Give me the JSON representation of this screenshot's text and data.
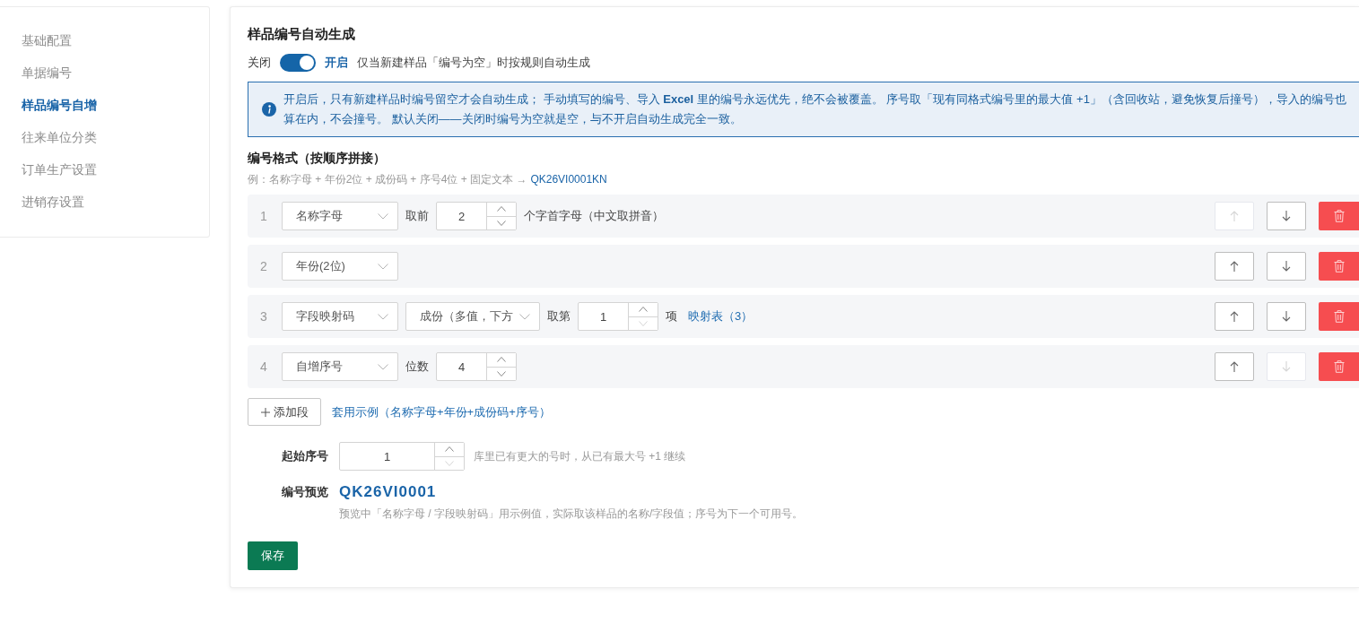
{
  "sidebar": {
    "items": [
      {
        "label": "基础配置",
        "selected": false
      },
      {
        "label": "单据编号",
        "selected": false
      },
      {
        "label": "样品编号自增",
        "selected": true
      },
      {
        "label": "往来单位分类",
        "selected": false
      },
      {
        "label": "订单生产设置",
        "selected": false
      },
      {
        "label": "进销存设置",
        "selected": false
      }
    ]
  },
  "section": {
    "title": "样品编号自动生成",
    "toggle": {
      "off_label": "关闭",
      "on": true,
      "on_label": "开启",
      "hint": "仅当新建样品「编号为空」时按规则自动生成"
    },
    "notice": "开启后，只有新建样品时编号留空才会自动生成； 手动填写的编号、导入 **Excel** 里的编号永远优先，绝不会被覆盖。 序号取「现有同格式编号里的最大值 +1」（含回收站，避免恢复后撞号），导入的编号也算在内，不会撞号。 默认关闭——关闭时编号为空就是空，与不开启自动生成完全一致。"
  },
  "format": {
    "title": "编号格式（按顺序拼接）",
    "example": "例：名称字母 + 年份2位 + 成份码 + 序号4位 + 固定文本 →",
    "example_result": "QK26VI0001KN",
    "segments": [
      {
        "index": "1",
        "type": "名称字母",
        "fields": [
          {
            "kind": "label",
            "text": "取前"
          },
          {
            "kind": "number",
            "value": "2",
            "decrease_disabled": false
          },
          {
            "kind": "text",
            "text": "个字首字母（中文取拼音）"
          }
        ],
        "up_disabled": true,
        "down_disabled": false
      },
      {
        "index": "2",
        "type": "年份(2位)",
        "up_disabled": false,
        "down_disabled": false
      },
      {
        "index": "3",
        "type": "字段映射码",
        "fields": [
          {
            "kind": "select",
            "text": "成份（多值，下方"
          },
          {
            "kind": "label",
            "text": "取第"
          },
          {
            "kind": "number",
            "value": "1",
            "decrease_disabled": true
          },
          {
            "kind": "text",
            "text": "项"
          },
          {
            "kind": "link",
            "text": "映射表（3）"
          }
        ],
        "up_disabled": false,
        "down_disabled": false
      },
      {
        "index": "4",
        "type": "自增序号",
        "fields": [
          {
            "kind": "label",
            "text": "位数"
          },
          {
            "kind": "number",
            "value": "4",
            "decrease_disabled": false
          }
        ],
        "up_disabled": false,
        "down_disabled": true
      }
    ],
    "add_button": "添加段",
    "apply_example_link": "套用示例（名称字母+年份+成份码+序号）"
  },
  "start": {
    "label": "起始序号",
    "value": "1",
    "decrease_disabled": true,
    "hint": "库里已有更大的号时，从已有最大号 +1 继续"
  },
  "preview": {
    "label": "编号预览",
    "value": "QK26VI0001",
    "note": "预览中「名称字母 / 字段映射码」用示例值，实际取该样品的名称/字段值；序号为下一个可用号。"
  },
  "save_button": "保存"
}
